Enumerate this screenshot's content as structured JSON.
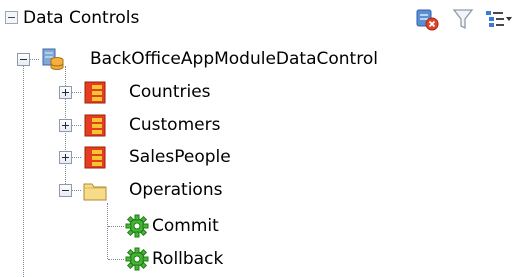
{
  "header": {
    "title": "Data Controls"
  },
  "tree": {
    "root": {
      "label": "BackOfficeAppModuleDataControl"
    },
    "collections": [
      {
        "label": "Countries"
      },
      {
        "label": "Customers"
      },
      {
        "label": "SalesPeople"
      }
    ],
    "operations": {
      "label": "Operations",
      "items": [
        {
          "label": "Commit"
        },
        {
          "label": "Rollback"
        }
      ]
    }
  }
}
